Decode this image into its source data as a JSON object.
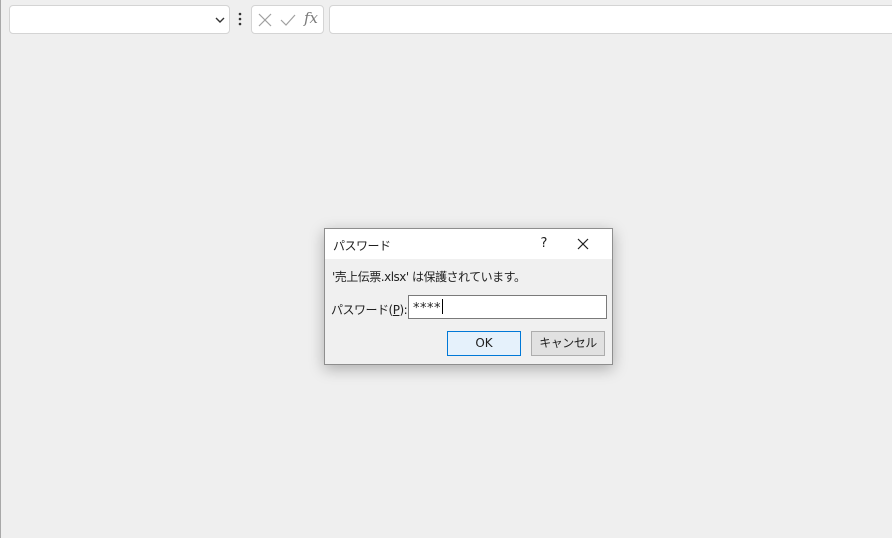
{
  "formula_bar": {
    "name_box_value": "",
    "formula_value": "",
    "fx_label": "fx",
    "icons": [
      "chevron-down-icon",
      "more-options-icon",
      "cancel-x-icon",
      "enter-check-icon"
    ]
  },
  "dialog": {
    "title": "パスワード",
    "help_label": "?",
    "close_icon": "close-icon",
    "message": "'売上伝票.xlsx' は保護されています。",
    "password_label_prefix": "パスワード(",
    "password_label_accel": "P",
    "password_label_suffix": "):",
    "password_value": "****",
    "ok_label": "OK",
    "cancel_label": "キャンセル"
  },
  "colors": {
    "background": "#efefef",
    "dialog_background": "#f0f0f0",
    "ok_button_border": "#0078d7",
    "ok_button_fill": "#e5f1fb"
  }
}
